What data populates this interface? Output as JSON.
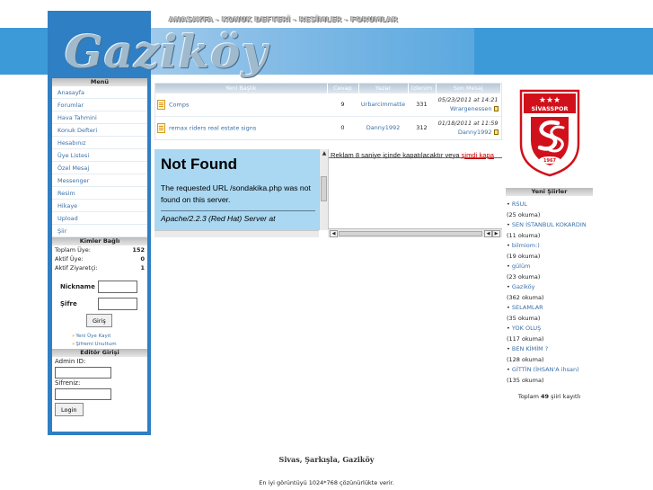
{
  "topnav": {
    "items": [
      "ANASAYFA",
      "KONUK DEFTERİ",
      "RESİMLER",
      "FORUMLAR"
    ],
    "separator": " - "
  },
  "logo": {
    "text": "Gaziköy"
  },
  "colors": {
    "accent": "#3d9ad8",
    "frame": "#2f7fc4",
    "link": "#3a6fa8",
    "red": "#cc0000",
    "panel": "#aad8f2"
  },
  "left": {
    "menu_title": "Menü",
    "menu_items": [
      "Anasayfa",
      "Forumlar",
      "Hava Tahmini",
      "Konuk Defteri",
      "Hesabınız",
      "Üye Listesi",
      "Özel Mesaj",
      "Messenger",
      "Resim",
      "Hikaye",
      "Upload",
      "Şiir"
    ],
    "members_title": "Kimler Bağlı",
    "stats": [
      {
        "label": "Toplam Üye:",
        "value": "152"
      },
      {
        "label": "Aktif Üye:",
        "value": "0"
      },
      {
        "label": "Aktif Ziyaretçi:",
        "value": "1"
      }
    ],
    "login": {
      "nickname_label": "Nickname",
      "password_label": "Şifre",
      "button": "Giriş",
      "new_member": "Yeni Üye Kayıt",
      "forgot": "Şifremi Unuttum"
    },
    "editor": {
      "title": "Editör Girişi",
      "admin_label": "Admin ID:",
      "password_label": "Sifreniz:",
      "button": "Login"
    }
  },
  "forum": {
    "headers": [
      "Yeni Başlık",
      "Cevap",
      "Yazar",
      "İzlenim",
      "Son Mesaj"
    ],
    "rows": [
      {
        "topic": "Comps",
        "replies": "9",
        "author": "Urbarcimmatte",
        "views": "331",
        "last_date": "05/23/2011 at 14:21",
        "last_user": "Wrargenessen"
      },
      {
        "topic": "remax riders real estate signs",
        "replies": "0",
        "author": "Danny1992",
        "views": "312",
        "last_date": "01/18/2011 at 11:59",
        "last_user": "Danny1992"
      }
    ]
  },
  "notfound": {
    "title": "Not Found",
    "message": "The requested URL /sondakika.php was not found on this server.",
    "server": "Apache/2.2.3 (Red Hat) Server at"
  },
  "ad": {
    "text": "Reklam 8 saniye içinde kapatılacaktır veya ",
    "link": "şimdi kapa"
  },
  "club": {
    "stars": "★★★",
    "name": "SİVASSPOR",
    "year": "1967"
  },
  "right": {
    "title": "Yeni Şiirler",
    "poems": [
      {
        "title": "RSUL",
        "count": "(25 okuma)"
      },
      {
        "title": "SEN İSTANBUL KOKARDIN",
        "count": "(11 okuma)"
      },
      {
        "title": "bilmiom:)",
        "count": "(19 okuma)"
      },
      {
        "title": "gülüm",
        "count": "(23 okuma)"
      },
      {
        "title": "Gaziköy",
        "count": "(362 okuma)"
      },
      {
        "title": "SELAMLAR",
        "count": "(35 okuma)"
      },
      {
        "title": "YOK OLUŞ",
        "count": "(117 okuma)"
      },
      {
        "title": "BEN KİMİM ?",
        "count": "(128 okuma)"
      },
      {
        "title": "GİTTİN (İHSAN'A ihsan)",
        "count": "(135 okuma)"
      }
    ],
    "total_prefix": "Toplam",
    "total_count": "49",
    "total_suffix": "şiiri kayıtlı"
  },
  "footer": {
    "brand": "Sivas, Şarkışla, Gaziköy",
    "note": "En iyi görüntüyü 1024*768 çözünürlükte verir."
  }
}
